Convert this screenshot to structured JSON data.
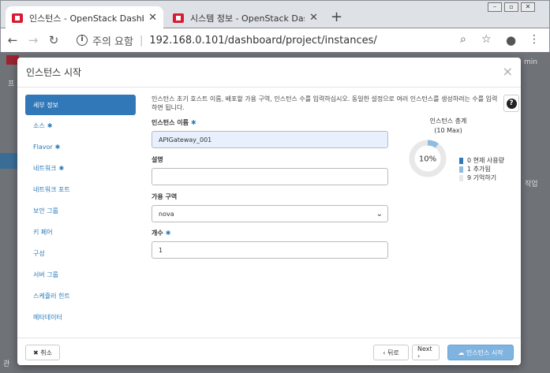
{
  "browser": {
    "tabs": [
      {
        "title": "인스턴스 - OpenStack Dashboar",
        "close": "✕"
      },
      {
        "title": "시스템 정보 - OpenStack Dashb",
        "close": "✕"
      }
    ],
    "new_tab": "+",
    "address": {
      "security_label": "주의 요함",
      "url": "192.168.0.101/dashboard/project/instances/"
    }
  },
  "background": {
    "right_text_1": "min",
    "right_text_2": "작업",
    "left_text_1": "프",
    "left_text_2": "관"
  },
  "modal": {
    "title": "인스턴스 시작",
    "close": "×",
    "help": "?",
    "nav": [
      {
        "label": "세부 정보",
        "required": false,
        "active": true
      },
      {
        "label": "소스",
        "required": true,
        "active": false
      },
      {
        "label": "Flavor",
        "required": true,
        "active": false
      },
      {
        "label": "네트워크",
        "required": true,
        "active": false
      },
      {
        "label": "네트워크 포트",
        "required": false,
        "active": false
      },
      {
        "label": "보안 그룹",
        "required": false,
        "active": false
      },
      {
        "label": "키 페어",
        "required": false,
        "active": false
      },
      {
        "label": "구성",
        "required": false,
        "active": false
      },
      {
        "label": "서버 그룹",
        "required": false,
        "active": false
      },
      {
        "label": "스케쥴러 힌트",
        "required": false,
        "active": false
      },
      {
        "label": "메타데이터",
        "required": false,
        "active": false
      }
    ],
    "required_mark": "✱",
    "description": "인스턴스 초기 호스트 이름, 배포할 가용 구역, 인스턴스 수를 입력하십시오. 동일한 설정으로 여러 인스턴스를 생성하려는 수를 입력하면 됩니다.",
    "fields": {
      "name_label": "인스턴스 이름",
      "name_value": "APIGateway_001",
      "desc_label": "설명",
      "desc_value": "",
      "zone_label": "가용 구역",
      "zone_value": "nova",
      "count_label": "개수",
      "count_value": "1"
    },
    "quota": {
      "title": "인스턴스 총계",
      "subtitle": "(10 Max)",
      "percent_label": "10%",
      "used_fraction": 0.1,
      "legend": [
        {
          "label": "0 현재 사용량",
          "color": "#3178b9"
        },
        {
          "label": "1 추가됨",
          "color": "#8fbde2"
        },
        {
          "label": "9 기억하기",
          "color": "#e8e8e8"
        }
      ]
    },
    "footer": {
      "cancel": "✖ 취소",
      "back": "‹ 뒤로",
      "next": "Next ›",
      "launch": "☁ 인스턴스 시작"
    }
  }
}
